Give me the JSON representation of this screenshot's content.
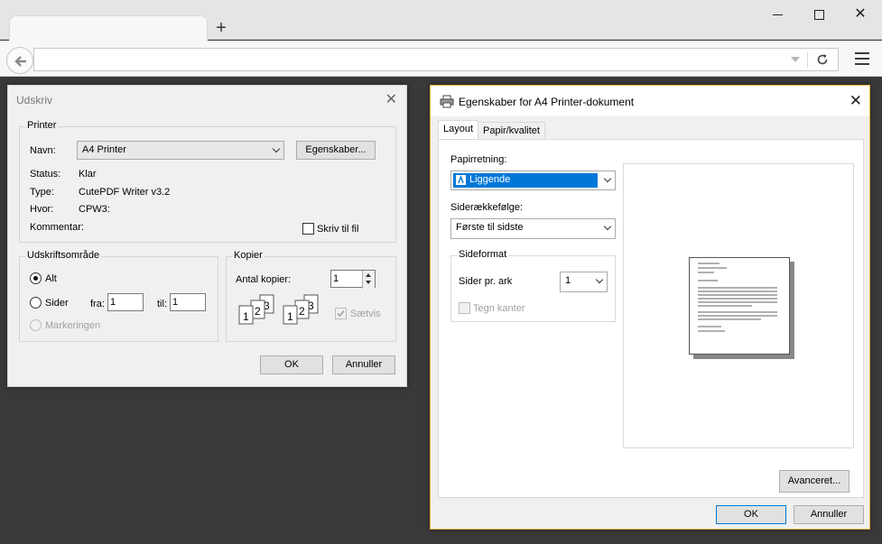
{
  "browser": {
    "tab_title": "",
    "new_tab": "+",
    "url": ""
  },
  "print_dialog": {
    "title": "Udskriv",
    "printer": {
      "group_label": "Printer",
      "name_label": "Navn:",
      "name_value": "A4 Printer",
      "properties_button": "Egenskaber...",
      "status_label": "Status:",
      "status_value": "Klar",
      "type_label": "Type:",
      "type_value": "CutePDF Writer v3.2",
      "where_label": "Hvor:",
      "where_value": "CPW3:",
      "comment_label": "Kommentar:",
      "print_to_file_label": "Skriv til fil"
    },
    "print_range": {
      "group_label": "Udskriftsområde",
      "all_label": "Alt",
      "pages_label": "Sider",
      "from_label": "fra:",
      "from_value": "1",
      "to_label": "til:",
      "to_value": "1",
      "selection_label": "Markeringen"
    },
    "copies": {
      "group_label": "Kopier",
      "count_label": "Antal kopier:",
      "count_value": "1",
      "collate_label": "Sætvis"
    },
    "ok_button": "OK",
    "cancel_button": "Annuller"
  },
  "properties_dialog": {
    "title": "Egenskaber for A4 Printer-dokument",
    "tabs": [
      "Layout",
      "Papir/kvalitet"
    ],
    "orientation_label": "Papirretning:",
    "orientation_value": "Liggende",
    "page_order_label": "Siderækkefølge:",
    "page_order_value": "Første til sidste",
    "page_format_group": "Sideformat",
    "pages_per_sheet_label": "Sider pr. ark",
    "pages_per_sheet_value": "1",
    "draw_borders_label": "Tegn kanter",
    "advanced_button": "Avanceret...",
    "ok_button": "OK",
    "cancel_button": "Annuller"
  },
  "colors": {
    "desktop": "#393939",
    "selection": "#0078d7",
    "active_border": "#e9b743"
  }
}
